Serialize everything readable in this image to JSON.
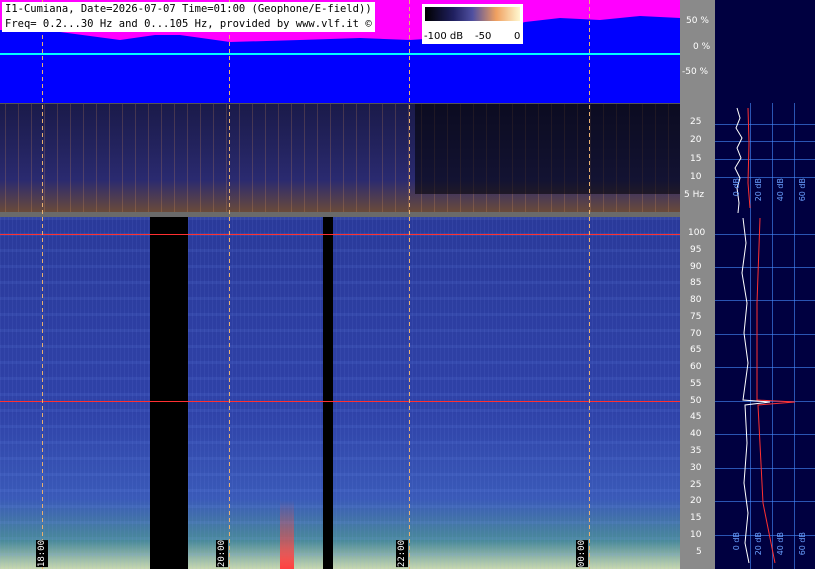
{
  "header": {
    "line1": "I1-Cumiana, Date=2026-07-07 Time=01:00 (Geophone/E-field))",
    "line2": "Freq= 0.2...30 Hz and 0...105 Hz, provided by www.vlf.it ©"
  },
  "legend": {
    "min": "-100 dB",
    "mid": "-50",
    "max": "0"
  },
  "top_axis": {
    "labels": [
      "50 %",
      "0 %",
      "-50 %"
    ]
  },
  "mid_axis": {
    "labels": [
      "25",
      "20",
      "15",
      "10",
      "5 Hz"
    ]
  },
  "low_axis": {
    "labels": [
      "100",
      "95",
      "90",
      "85",
      "80",
      "75",
      "70",
      "65",
      "60",
      "55",
      "50",
      "45",
      "40",
      "35",
      "30",
      "25",
      "20",
      "15",
      "10",
      "5"
    ]
  },
  "time_labels": [
    "18:00",
    "20:00",
    "22:00",
    "00:00"
  ],
  "side_mid_labels": [
    "0 dB",
    "20 dB",
    "40 dB",
    "60 dB"
  ],
  "side_low_labels": [
    "0 dB",
    "20 dB",
    "40 dB",
    "60 dB"
  ],
  "colors": {
    "top_bg": "#0000ff",
    "magenta": "#ff00ff",
    "cyan_line": "#00ffff",
    "red_line": "#ff2020"
  }
}
